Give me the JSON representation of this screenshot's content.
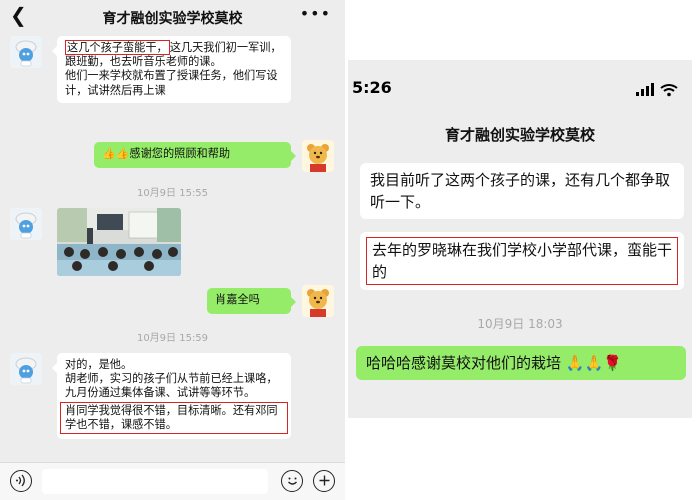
{
  "left": {
    "back_icon": "chevron-left",
    "title": "育才融创实验学校莫校",
    "more_icon": "ellipsis",
    "msg1": {
      "highlight": "这几个孩子蛮能干，",
      "rest": "这几天我们初一军训，跟班勤，也去听音乐老师的课。",
      "line2": "他们一来学校就布置了授课任务，他们写设计，试讲然后再上课"
    },
    "msg2": {
      "emoji_icons": "thumbs-up thumbs-up",
      "text": "感谢您的照顾和帮助"
    },
    "ts1": "10月9日 15:55",
    "photo_icon": "classroom-photo",
    "msg3": {
      "text": "肖嘉全吗"
    },
    "ts2": "10月9日 15:59",
    "msg4": {
      "line1": "对的，是他。",
      "line2": "胡老师，实习的孩子们从节前已经上课咯，九月份通过集体备课、试讲等等环节。",
      "highlight": "肖同学我觉得很不错，目标清晰。还有邓同学也不错，课感不错。"
    },
    "input_bar": {
      "voice_icon": "voice-icon",
      "emoji_icon": "emoji-icon",
      "plus_icon": "plus-icon"
    }
  },
  "right": {
    "time": "5:26",
    "status_icons": "signal wifi",
    "title": "育才融创实验学校莫校",
    "msg1": "我目前听了这两个孩子的课，还有几个都争取听一下。",
    "msg2": "去年的罗晓琳在我们学校小学部代课，蛮能干的",
    "ts": "10月9日 18:03",
    "msg3": "哈哈哈感谢莫校对他们的栽培",
    "msg3_icons": "pray pray rose"
  },
  "colors": {
    "bubble_green": "#95ec69",
    "chat_bg": "#ededed",
    "highlight_red": "#d62525"
  }
}
